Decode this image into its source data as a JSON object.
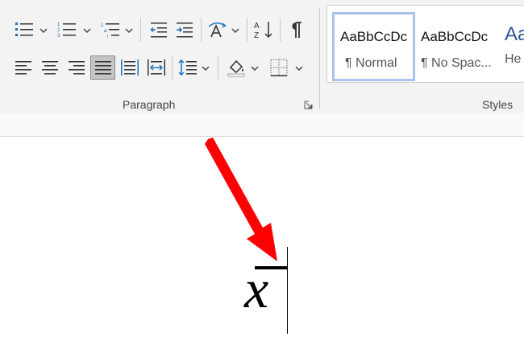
{
  "ribbon": {
    "paragraph_group_label": "Paragraph",
    "styles_group_label": "Styles",
    "paragraph_buttons": [
      "bullets-icon",
      "numbering-icon",
      "multilevel-list-icon",
      "decrease-indent-icon",
      "increase-indent-icon",
      "sort-icon",
      "show-formatting-marks-icon",
      "align-left-icon",
      "center-icon",
      "align-right-icon",
      "justify-icon",
      "distributed-icon",
      "text-direction-icon",
      "line-spacing-icon",
      "shading-icon",
      "borders-icon"
    ],
    "styles": [
      {
        "sample": "AaBbCcDc",
        "name": "¶ Normal",
        "selected": true
      },
      {
        "sample": "AaBbCcDc",
        "name": "¶ No Spac...",
        "selected": false
      },
      {
        "sample": "Aa",
        "name": "He",
        "selected": false
      }
    ]
  },
  "document": {
    "equation": "x",
    "accent_color": "#ff0000"
  }
}
